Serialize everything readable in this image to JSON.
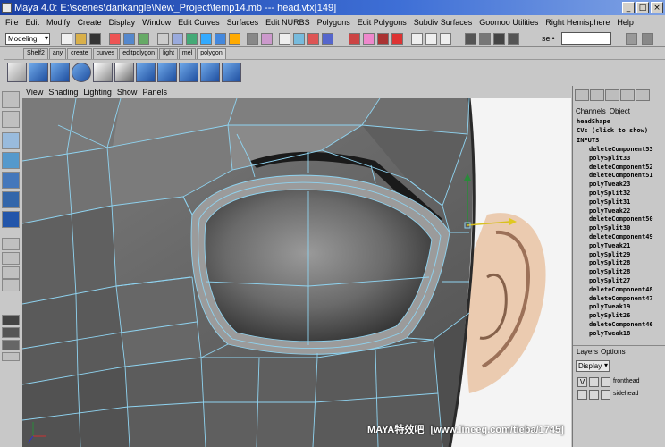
{
  "window": {
    "title": "Maya 4.0: E:\\scenes\\dankangle\\New_Project\\temp14.mb  ---  head.vtx[149]",
    "controls": [
      "_",
      "□",
      "×"
    ]
  },
  "menubar": {
    "items": [
      "File",
      "Edit",
      "Modify",
      "Create",
      "Display",
      "Window",
      "Edit Curves",
      "Surfaces",
      "Edit NURBS",
      "Polygons",
      "Edit Polygons",
      "Subdiv Surfaces",
      "Goomoo Utilities",
      "Right Hemisphere",
      "Help"
    ]
  },
  "statusline": {
    "mode": "Modeling",
    "sel_label": "sel•",
    "sel_value": ""
  },
  "shelf": {
    "tabs": [
      "Shelf2",
      "any",
      "create",
      "curves",
      "editpolygon",
      "light",
      "mel",
      "polygon"
    ],
    "active_tab": "polygon"
  },
  "viewport": {
    "menu": [
      "View",
      "Shading",
      "Lighting",
      "Show",
      "Panels"
    ]
  },
  "watermark": {
    "brand": "MAYA特效吧",
    "url": "[www.lineeg.com/tieba/1745]"
  },
  "channel_box": {
    "tabs": [
      "Channels",
      "Object"
    ],
    "shape": "headShape",
    "cvs": "CVs (click to show)",
    "inputs_label": "INPUTS",
    "history": [
      "deleteComponent53",
      "polySplit33",
      "deleteComponent52",
      "deleteComponent51",
      "polyTweak23",
      "polySplit32",
      "polySplit31",
      "polyTweak22",
      "deleteComponent50",
      "polySplit30",
      "deleteComponent49",
      "polyTweak21",
      "polySplit29",
      "polySplit28",
      "polySplit28",
      "polySplit27",
      "deleteComponent48",
      "deleteComponent47",
      "polyTweak19",
      "polySplit26",
      "deleteComponent46",
      "polyTweak18"
    ]
  },
  "layers": {
    "tabs": [
      "Layers",
      "Options"
    ],
    "display": "Display",
    "items": [
      {
        "visible": "V",
        "name": "fronthead"
      },
      {
        "visible": "",
        "name": "sidehead"
      }
    ]
  },
  "colors": {
    "wire": "#8fd3f0",
    "face_dark": "#3c3c3c",
    "face_light": "#8a8a8a",
    "title_bar": "#1a3fa3",
    "ear_skin": "#e9c3a3"
  }
}
